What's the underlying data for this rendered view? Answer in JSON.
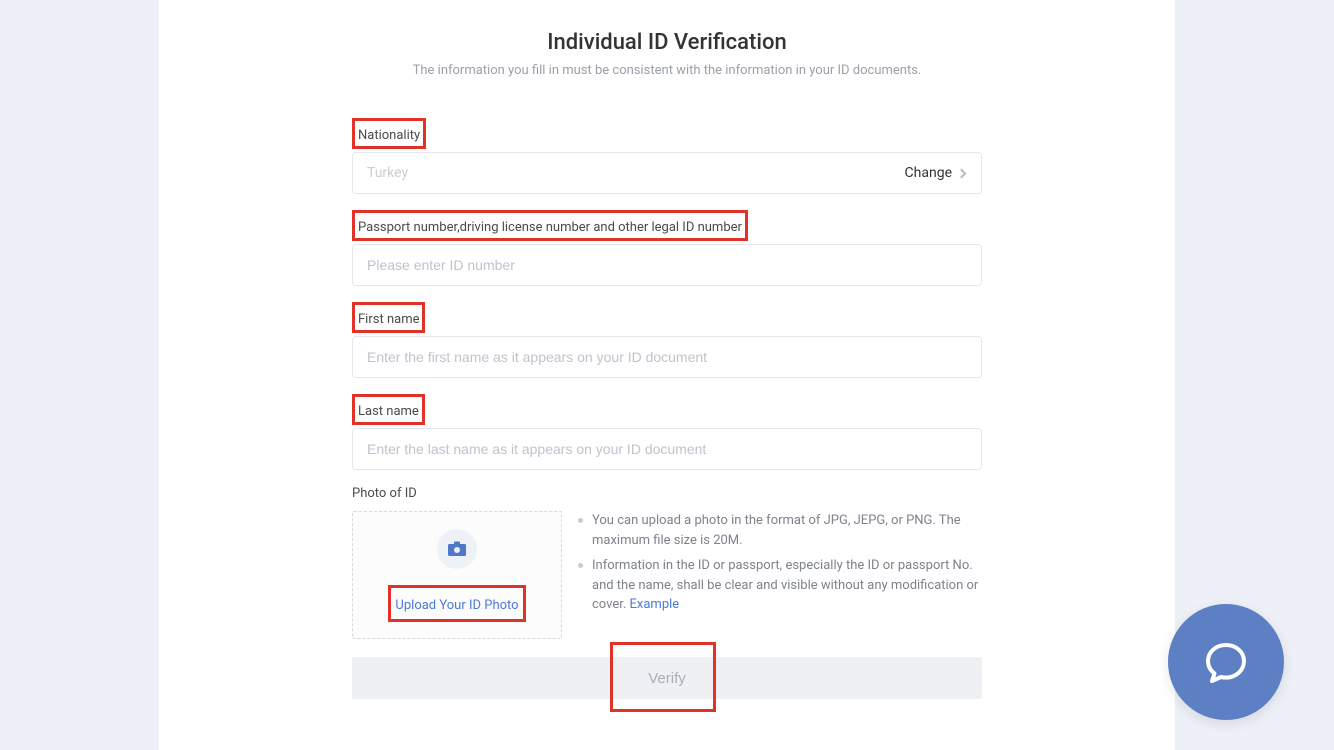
{
  "header": {
    "title": "Individual ID Verification",
    "subtitle": "The information you fill in must be consistent with the information in your ID documents."
  },
  "fields": {
    "nationality": {
      "label": "Nationality",
      "value": "Turkey",
      "change_label": "Change"
    },
    "id_number": {
      "label": "Passport number,driving license number and other legal ID number",
      "placeholder": "Please enter ID number"
    },
    "first_name": {
      "label": "First name",
      "placeholder": "Enter the first name as it appears on your ID document"
    },
    "last_name": {
      "label": "Last name",
      "placeholder": "Enter the last name as it appears on your ID document"
    }
  },
  "photo": {
    "label": "Photo of ID",
    "upload_label": "Upload Your ID Photo",
    "info_1": "You can upload a photo in the format of JPG, JEPG, or PNG. The maximum file size is 20M.",
    "info_2": "Information in the ID or passport, especially the ID or passport No. and the name, shall be clear and visible without any modification or cover. ",
    "example_label": "Example"
  },
  "verify_label": "Verify"
}
